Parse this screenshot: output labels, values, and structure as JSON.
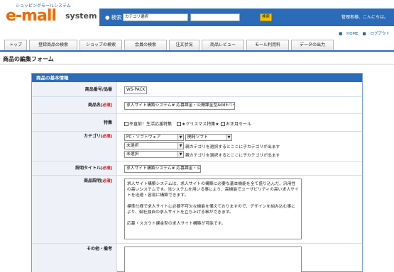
{
  "header": {
    "tagline": "ショッピングモールシステム",
    "logo": "e-mall",
    "logo_sub": "system",
    "search_label": "検索",
    "search_category": "カテゴリ選択",
    "search_button": "検索",
    "welcome": "管理者様、こんにちは。"
  },
  "links": {
    "home": "HOME",
    "logout": "ログアウト"
  },
  "tabs": [
    "トップ",
    "登録商品の検索",
    "ショップの検索",
    "会員の検索",
    "注文状況",
    "商品レビュー",
    "モール利用料",
    "データの出力"
  ],
  "page_title": "商品の編集フォーム",
  "panel_title": "商品の基本情報",
  "required": "[必須]",
  "form": {
    "product_code": {
      "label": "商品番号/品番",
      "value": "WS-PACK"
    },
    "product_name": {
      "label": "商品名",
      "value": "求人サイト構築システム# 応募課金・公開課金型AddEバイ"
    },
    "features": {
      "label": "特集",
      "options": [
        "冬直前！生活応援特集",
        "★クリスマス特集★",
        "お正月セール"
      ]
    },
    "category": {
      "label": "カテゴリ",
      "rows": [
        {
          "first": "PC・ソフトウェア",
          "second": "開発ソフト",
          "note": ""
        },
        {
          "first": "未選択",
          "second": "",
          "note": "親カテゴリを選択するとここに子カテゴリが出ます"
        },
        {
          "first": "未選択",
          "second": "",
          "note": "親カテゴリを選択するとここに子カテゴリが出ます"
        }
      ]
    },
    "desc_title": {
      "label": "説明タイトル",
      "value": "求人サイト構築システム# 応募課金・公"
    },
    "description": {
      "label": "商品説明",
      "paragraphs": [
        "求人サイト構築システムは、求人サイトの構築に必要な基本機能を全て盛り込んだ、汎用性の高いシステムです。当システムを用いる事により、高機能でユーザビリティの高い求人サイトを迅速・容易に構築できます。",
        "標準仕様で求人サイトに必要不可欠な機能を備えておりますので、デザインを組み込む事により、御社独自の求人サイトを立ち上げる事ができます。",
        "応募・スカウト課金型の求人サイト構築が可能です。"
      ]
    },
    "other": {
      "label": "その他・備考",
      "value": ""
    }
  }
}
